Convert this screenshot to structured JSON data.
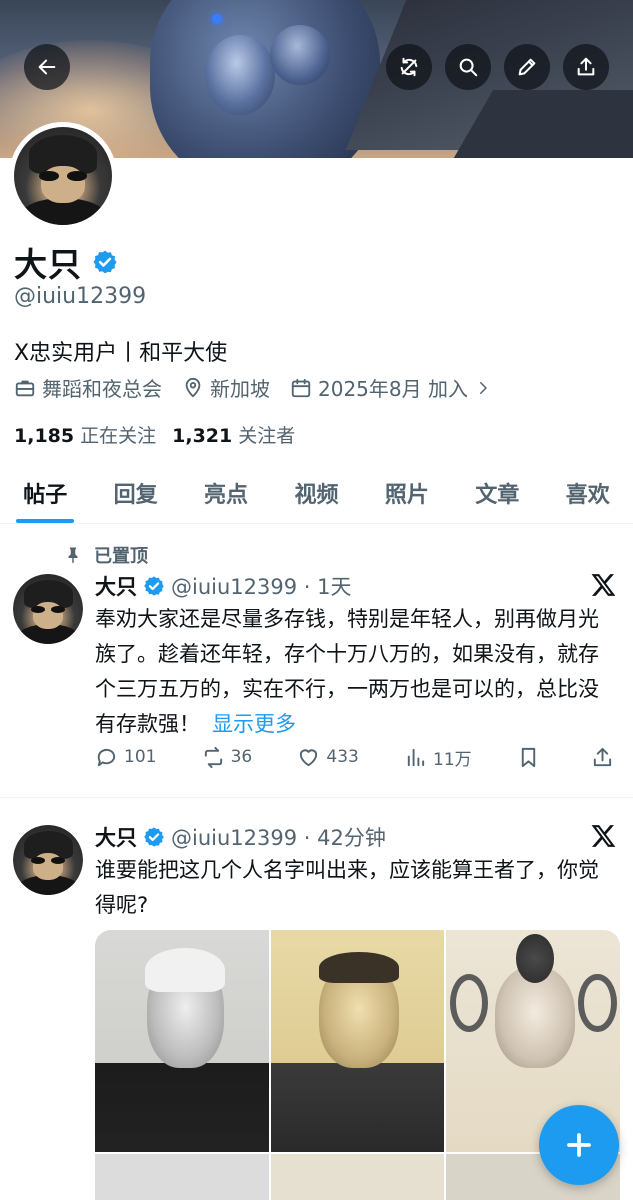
{
  "profile": {
    "name": "大只",
    "handle": "@iuiu12399",
    "bio": "X忠实用户丨和平大使",
    "category": "舞蹈和夜总会",
    "location": "新加坡",
    "joined": "2025年8月 加入",
    "following_count": "1,185",
    "following_label": "正在关注",
    "followers_count": "1,321",
    "followers_label": "关注者"
  },
  "tabs": [
    "帖子",
    "回复",
    "亮点",
    "视频",
    "照片",
    "文章",
    "喜欢"
  ],
  "active_tab": "帖子",
  "posts": [
    {
      "pinned_label": "已置顶",
      "name": "大只",
      "handle_time": "@iuiu12399 · 1天",
      "text": "奉劝大家还是尽量多存钱，特别是年轻人，别再做月光族了。趁着还年轻，存个十万八万的，如果没有，就存个三万五万的，实在不行，一两万也是可以的，总比没有存款强！",
      "show_more": "显示更多",
      "replies": "101",
      "reposts": "36",
      "likes": "433",
      "views": "11万"
    },
    {
      "name": "大只",
      "handle_time": "@iuiu12399 · 42分钟",
      "text": "谁要能把这几个人名字叫出来，应该能算王者了，你觉得呢?"
    }
  ],
  "colors": {
    "accent": "#1d9bf0",
    "text_primary": "#0f1419",
    "text_secondary": "#536471"
  },
  "icons": [
    "back-arrow-icon",
    "cycle-icon",
    "search-icon",
    "edit-pencil-icon",
    "share-icon",
    "verified-badge-icon",
    "briefcase-icon",
    "location-pin-icon",
    "calendar-icon",
    "pin-icon",
    "x-logo-icon",
    "reply-icon",
    "repost-icon",
    "like-icon",
    "views-icon",
    "bookmark-icon",
    "plus-icon"
  ]
}
